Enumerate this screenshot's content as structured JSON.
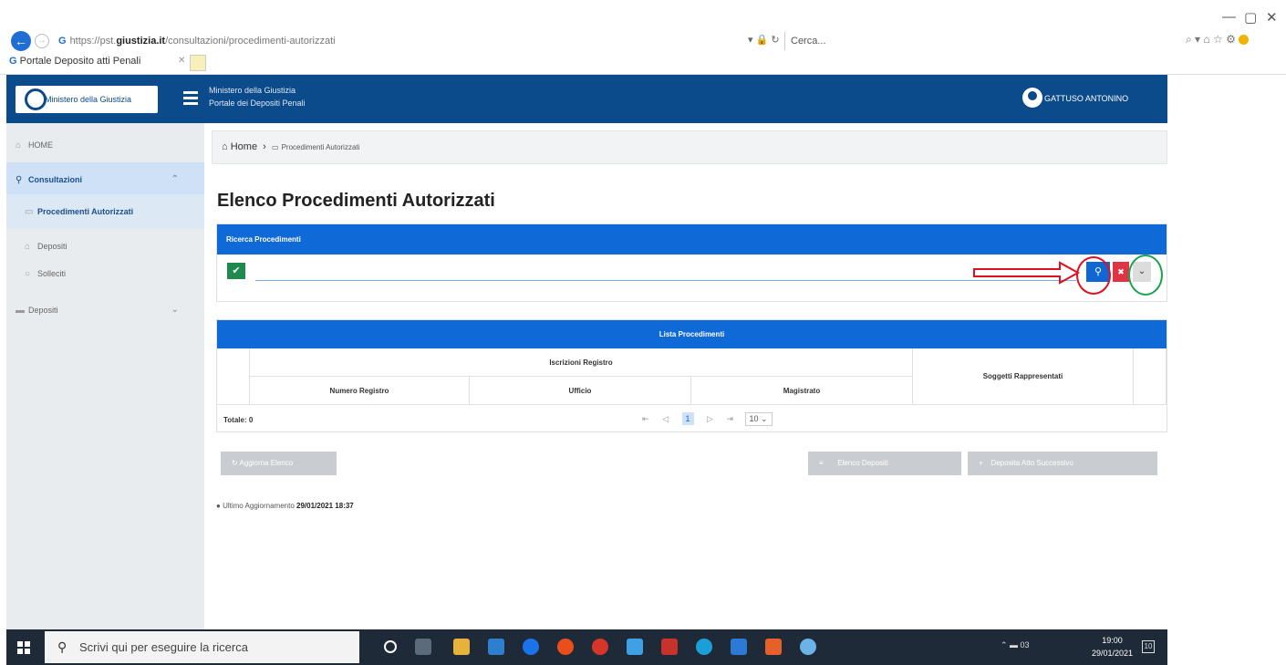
{
  "browser": {
    "url_prefix": "https://pst.",
    "url_domain": "giustizia.it",
    "url_path": "/consultazioni/procedimenti-autorizzati",
    "search_placeholder": "Cerca...",
    "tab_title": "Portale Deposito atti Penali",
    "win_min": "—",
    "win_max": "▢",
    "win_close": "✕"
  },
  "header": {
    "logo_text": "Ministero della Giustizia",
    "title_line1": "Ministero della Giustizia",
    "title_line2": "Portale dei Depositi Penali",
    "user_name": "GATTUSO ANTONINO"
  },
  "sidebar": {
    "items": [
      {
        "label": "HOME",
        "icon": "home-icon"
      },
      {
        "label": "Consultazioni",
        "icon": "search-icon"
      },
      {
        "label": "Procedimenti Autorizzati",
        "icon": "folder-icon"
      },
      {
        "label": "Depositi",
        "icon": "bank-icon"
      },
      {
        "label": "Solleciti",
        "icon": "circle-icon"
      },
      {
        "label": "Depositi",
        "icon": "graduation-icon"
      }
    ]
  },
  "breadcrumb": {
    "home": "Home",
    "current": "Procedimenti Autorizzati"
  },
  "main": {
    "page_title": "Elenco Procedimenti Autorizzati",
    "search_panel_title": "Ricerca Procedimenti",
    "list_panel_title": "Lista Procedimenti",
    "columns": {
      "group": "Iscrizioni Registro",
      "numero": "Numero Registro",
      "ufficio": "Ufficio",
      "magistrato": "Magistrato",
      "soggetti": "Soggetti Rappresentati"
    },
    "totale": "Totale: 0",
    "pager": {
      "current_page": "1",
      "page_size": "10"
    },
    "buttons": {
      "aggiorna": "Aggiorna Elenco",
      "elenco_depositi": "Elenco Depositi",
      "deposita": "Deposita Atto Successivo"
    },
    "updated_label": "Ultimo Aggiornamento",
    "updated_value": "29/01/2021 18:37"
  },
  "taskbar": {
    "search_placeholder": "Scrivi qui per eseguire la ricerca",
    "time": "19:00",
    "date": "29/01/2021",
    "lang": "03"
  },
  "colors": {
    "header_bg": "#0b4a8b",
    "panel_blue": "#0f6ad8",
    "annotation_red": "#e0101f",
    "annotation_green": "#16a34a"
  }
}
